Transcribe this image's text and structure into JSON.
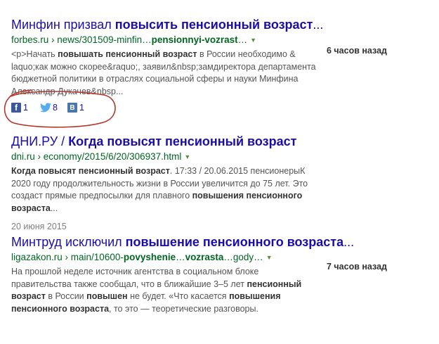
{
  "results": [
    {
      "title_plain": "Минфин призвал ",
      "title_bold": "повысить пенсионный возраст",
      "title_end": "...",
      "url_plain": "forbes.ru › news/301509-minfin…",
      "url_bold": "pensionnyi-vozrast",
      "url_end": "…",
      "snippet_1": "<p>Начать ",
      "snippet_2": "повышать пенсионный возраст",
      "snippet_3": " в России необходимо & laquo;как можно скорее&raquo;, заявил&nbsp;замдиректора департамента бюджетной политики в отраслях социальной сферы и науки Минфина Александр Дукачев&nbsp...",
      "time": "6 часов назад",
      "social": {
        "facebook_count": "1",
        "twitter_count": "8",
        "vk_count": "1"
      }
    },
    {
      "title_plain": "ДНИ.РУ / ",
      "title_bold": "Когда повысят пенсионный возраст",
      "url_plain": "dni.ru › economy/2015/6/20/306937.html",
      "snippet_1": "Когда повысят пенсионный возраст",
      "snippet_2": ". 17:33 / 20.06.2015 пенсионерыК 2020 году продолжительность жизни в России увеличится до 75 лет. Это создаст прямые предпосылки для плавного ",
      "snippet_3": "повышения пенсионного возраста",
      "snippet_4": "...",
      "date": "20 июня 2015"
    },
    {
      "title_plain": "Минтруд исключил ",
      "title_bold": "повышение пенсионного возраста",
      "title_end": "...",
      "url_plain": "ligazakon.ru › main/10600-",
      "url_bold_1": "povyshenie",
      "url_mid": "…",
      "url_bold_2": "vozrasta",
      "url_end": "…gody…",
      "snippet_1": "На прошлой неделе источник агентства в социальном блоке правительства также сообщал, что в ближайшие 3–5 лет ",
      "snippet_2": "пенсионный возраст",
      "snippet_3": " в России ",
      "snippet_4": "повышен",
      "snippet_5": " не будет. «Что касается ",
      "snippet_6": "повышения пенсионного возраста",
      "snippet_7": ", то это — теоретические разговоры.",
      "time": "7 часов назад"
    }
  ],
  "icons": {
    "dropdown": "dropdown-arrow-icon",
    "facebook": "facebook-icon",
    "twitter": "twitter-icon",
    "vk": "vk-icon"
  },
  "colors": {
    "title": "#1a0dab",
    "url": "#006621",
    "snippet": "#545454",
    "circle": "#b5352a"
  }
}
